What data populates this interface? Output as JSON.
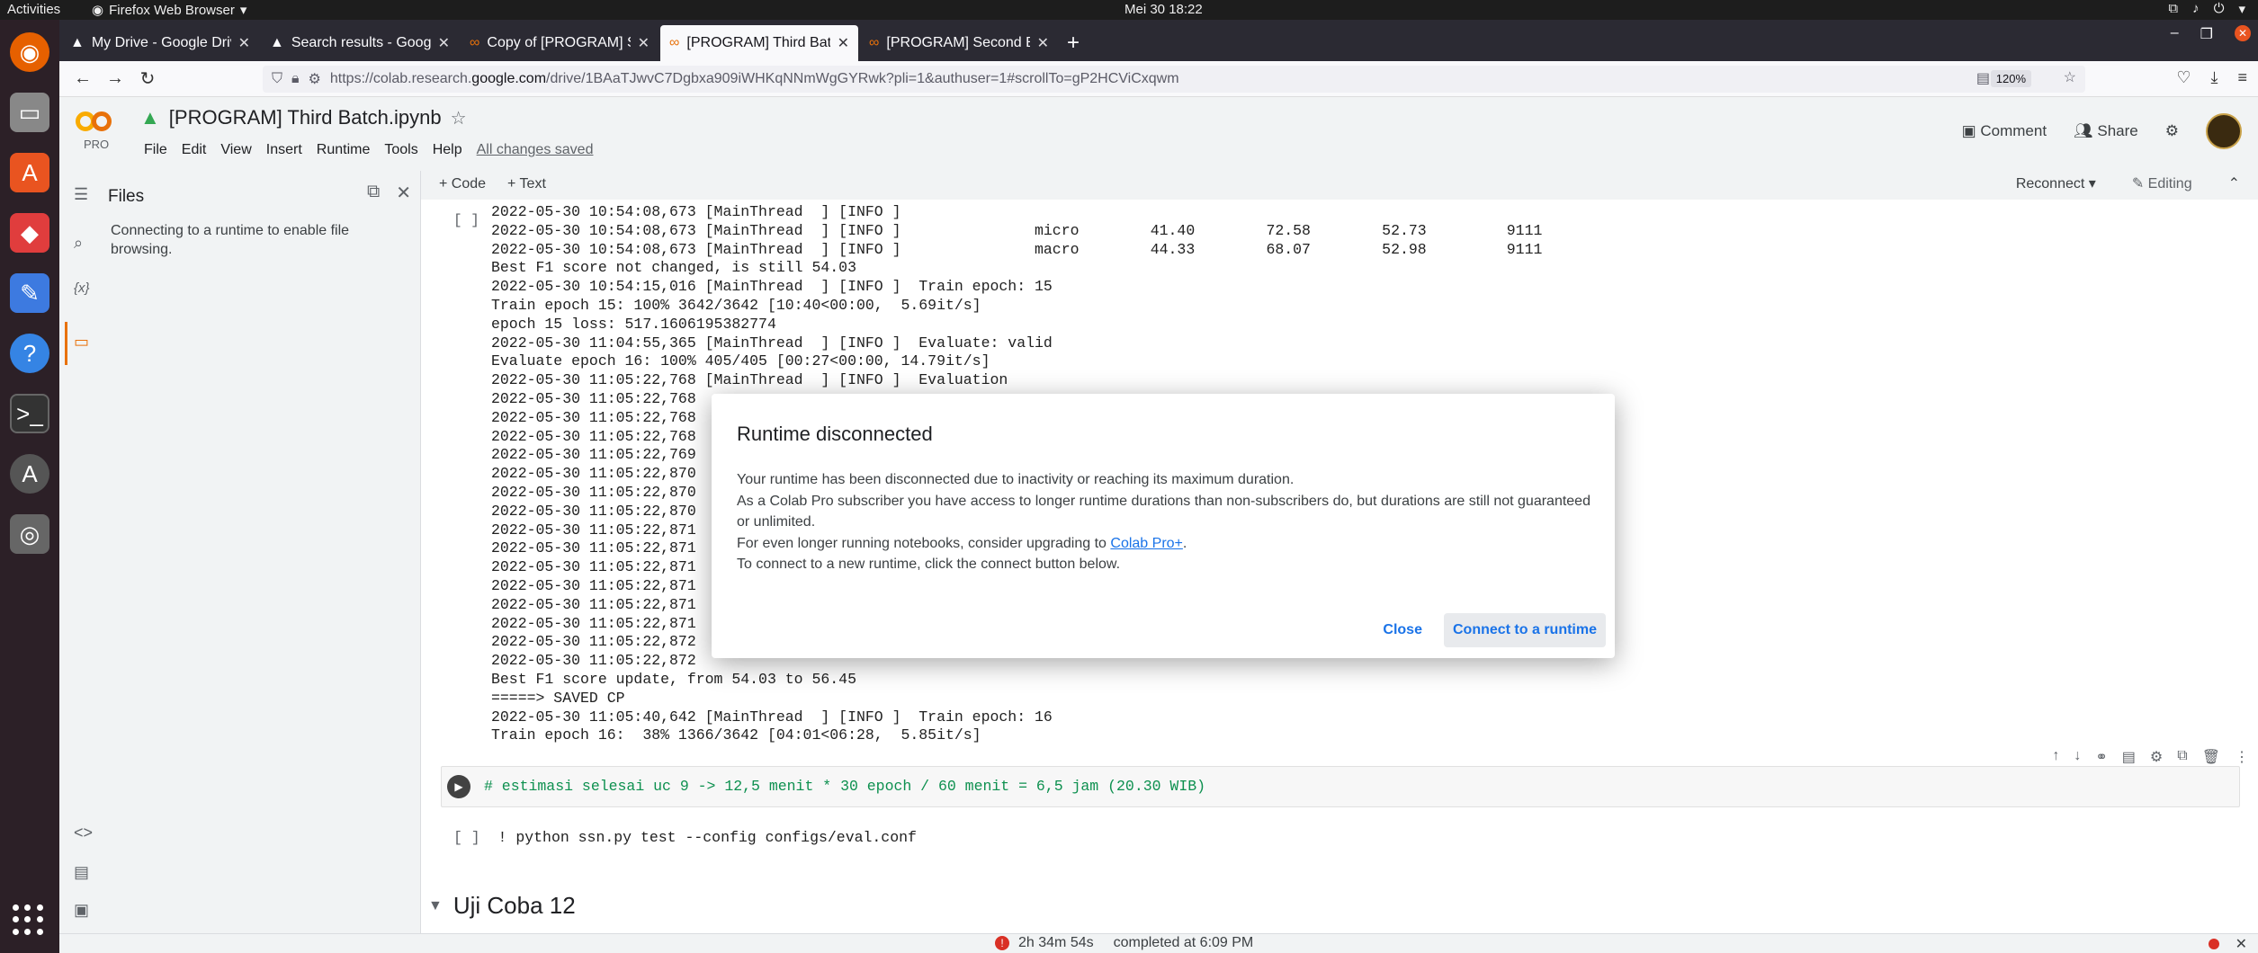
{
  "system": {
    "activities": "Activities",
    "app_menu": "Firefox Web Browser",
    "clock": "Mei 30  18:22"
  },
  "browser": {
    "tabs": [
      {
        "title": "My Drive - Google Drive"
      },
      {
        "title": "Search results - Google D"
      },
      {
        "title": "Copy of [PROGRAM] Sec"
      },
      {
        "title": "[PROGRAM] Third Batch"
      },
      {
        "title": "[PROGRAM] Second Batc"
      }
    ],
    "url_prefix": "https://colab.research.",
    "url_domain": "google.com",
    "url_rest": "/drive/1BAaTJwvC7Dgbxa909iWHKqNNmWgGYRwk?pli=1&authuser=1#scrollTo=gP2HCViCxqwm",
    "zoom": "120%"
  },
  "colab": {
    "pro_label": "PRO",
    "notebook_title": "[PROGRAM] Third Batch.ipynb",
    "menus": [
      "File",
      "Edit",
      "View",
      "Insert",
      "Runtime",
      "Tools",
      "Help"
    ],
    "saved_status": "All changes saved",
    "comment_label": "Comment",
    "share_label": "Share",
    "add_code": "+ Code",
    "add_text": "+ Text",
    "reconnect_label": "Reconnect",
    "editing_label": "Editing"
  },
  "files_panel": {
    "title": "Files",
    "message": "Connecting to a runtime to enable file browsing."
  },
  "output": {
    "cell_bracket": "[ ]",
    "lines": [
      "2022-05-30 10:54:08,673 [MainThread  ] [INFO ]",
      "2022-05-30 10:54:08,673 [MainThread  ] [INFO ]               micro        41.40        72.58        52.73         9111",
      "2022-05-30 10:54:08,673 [MainThread  ] [INFO ]               macro        44.33        68.07        52.98         9111",
      "Best F1 score not changed, is still 54.03",
      "2022-05-30 10:54:15,016 [MainThread  ] [INFO ]  Train epoch: 15",
      "Train epoch 15: 100% 3642/3642 [10:40<00:00,  5.69it/s]",
      "epoch 15 loss: 517.1606195382774",
      "2022-05-30 11:04:55,365 [MainThread  ] [INFO ]  Evaluate: valid",
      "Evaluate epoch 16: 100% 405/405 [00:27<00:00, 14.79it/s]",
      "2022-05-30 11:05:22,768 [MainThread  ] [INFO ]  Evaluation",
      "2022-05-30 11:05:22,768",
      "2022-05-30 11:05:22,768",
      "2022-05-30 11:05:22,768                                                                                           ectly",
      "2022-05-30 11:05:22,769",
      "2022-05-30 11:05:22,870",
      "2022-05-30 11:05:22,870",
      "2022-05-30 11:05:22,870",
      "2022-05-30 11:05:22,871",
      "2022-05-30 11:05:22,871",
      "2022-05-30 11:05:22,871",
      "2022-05-30 11:05:22,871",
      "2022-05-30 11:05:22,871",
      "2022-05-30 11:05:22,871",
      "2022-05-30 11:05:22,872",
      "2022-05-30 11:05:22,872",
      "Best F1 score update, from 54.03 to 56.45",
      "=====> SAVED CP",
      "2022-05-30 11:05:40,642 [MainThread  ] [INFO ]  Train epoch: 16",
      "Train epoch 16:  38% 1366/3642 [04:01<06:28,  5.85it/s]"
    ]
  },
  "cells": {
    "comment_cell": "# estimasi selesai uc 9 -> 12,5 menit * 30 epoch / 60 menit = 6,5 jam (20.30 WIB)",
    "cmd_bracket": "[ ]",
    "cmd_cell": "! python ssn.py test --config configs/eval.conf",
    "section_title": "Uji Coba 12"
  },
  "statusbar": {
    "duration": "2h 34m 54s",
    "completed": "completed at 6:09 PM"
  },
  "dialog": {
    "title": "Runtime disconnected",
    "line1": "Your runtime has been disconnected due to inactivity or reaching its maximum duration.",
    "line2": "As a Colab Pro subscriber you have access to longer runtime durations than non-subscribers do, but durations are still not guaranteed or unlimited.",
    "line3_prefix": "For even longer running notebooks, consider upgrading to ",
    "line3_link": "Colab Pro+",
    "line3_suffix": ".",
    "line4": "To connect to a new runtime, click the connect button below.",
    "close_label": "Close",
    "connect_label": "Connect to a runtime"
  },
  "colors": {
    "accent": "#1a73e8",
    "dock_bg": "#2c2027",
    "tabbar_bg": "#2b2a33",
    "error": "#d93025"
  }
}
